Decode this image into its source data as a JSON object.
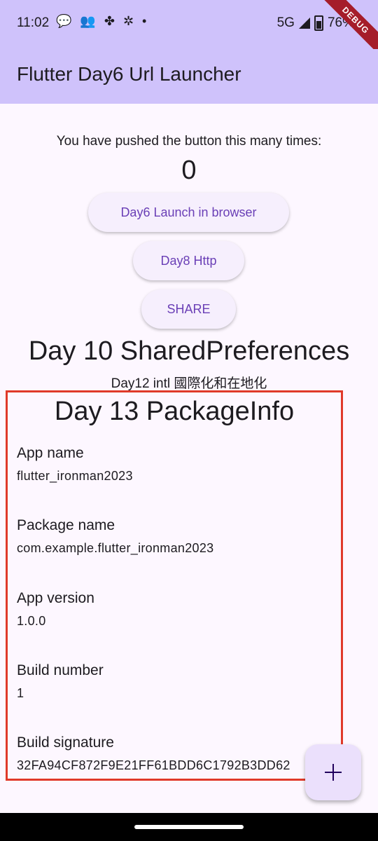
{
  "status_bar": {
    "time": "11:02",
    "network": "5G",
    "battery": "76%",
    "debug": "DEBUG"
  },
  "app_bar": {
    "title": "Flutter Day6 Url Launcher"
  },
  "main": {
    "pushed_label": "You have pushed the button this many times:",
    "counter": "0",
    "buttons": {
      "launch": "Day6 Launch in browser",
      "http": "Day8 Http",
      "share": "SHARE"
    },
    "shared_prefs_title": "Day 10 SharedPreferences",
    "intl_label": "Day12 intl 國際化和在地化"
  },
  "package_info": {
    "title": "Day 13 PackageInfo",
    "items": [
      {
        "label": "App name",
        "value": "flutter_ironman2023"
      },
      {
        "label": "Package name",
        "value": "com.example.flutter_ironman2023"
      },
      {
        "label": "App version",
        "value": "1.0.0"
      },
      {
        "label": "Build number",
        "value": "1"
      },
      {
        "label": "Build signature",
        "value": "32FA94CF872F9E21FF61BDD6C1792B3DD62"
      }
    ]
  },
  "icons": {
    "status": [
      "chat-bubble-icon",
      "people-icon",
      "fan-icon",
      "dance-icon",
      "dot-icon"
    ],
    "fab": "plus-icon"
  },
  "colors": {
    "app_bar": "#cfc2fb",
    "background": "#fdf7ff",
    "button_text": "#6a3fb6",
    "highlight_border": "#e03a2a"
  }
}
